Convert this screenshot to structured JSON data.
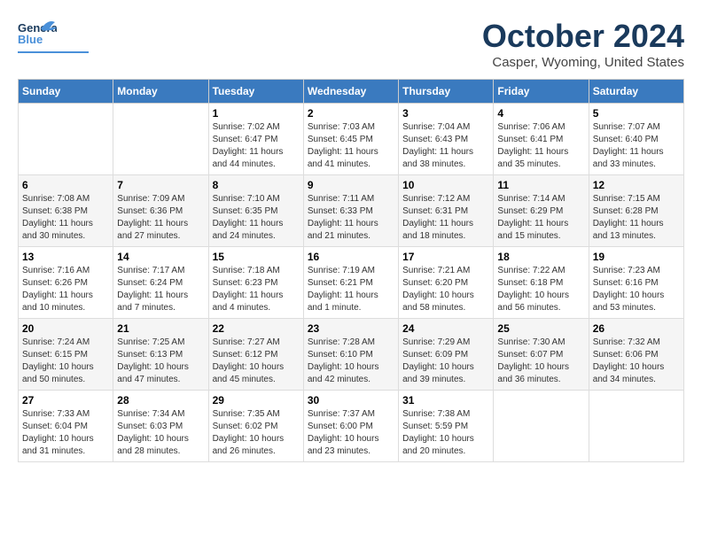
{
  "header": {
    "logo_general": "General",
    "logo_blue": "Blue",
    "month_title": "October 2024",
    "location": "Casper, Wyoming, United States"
  },
  "days_of_week": [
    "Sunday",
    "Monday",
    "Tuesday",
    "Wednesday",
    "Thursday",
    "Friday",
    "Saturday"
  ],
  "weeks": [
    [
      {
        "day": "",
        "info": ""
      },
      {
        "day": "",
        "info": ""
      },
      {
        "day": "1",
        "sunrise": "7:02 AM",
        "sunset": "6:47 PM",
        "daylight": "11 hours and 44 minutes."
      },
      {
        "day": "2",
        "sunrise": "7:03 AM",
        "sunset": "6:45 PM",
        "daylight": "11 hours and 41 minutes."
      },
      {
        "day": "3",
        "sunrise": "7:04 AM",
        "sunset": "6:43 PM",
        "daylight": "11 hours and 38 minutes."
      },
      {
        "day": "4",
        "sunrise": "7:06 AM",
        "sunset": "6:41 PM",
        "daylight": "11 hours and 35 minutes."
      },
      {
        "day": "5",
        "sunrise": "7:07 AM",
        "sunset": "6:40 PM",
        "daylight": "11 hours and 33 minutes."
      }
    ],
    [
      {
        "day": "6",
        "sunrise": "7:08 AM",
        "sunset": "6:38 PM",
        "daylight": "11 hours and 30 minutes."
      },
      {
        "day": "7",
        "sunrise": "7:09 AM",
        "sunset": "6:36 PM",
        "daylight": "11 hours and 27 minutes."
      },
      {
        "day": "8",
        "sunrise": "7:10 AM",
        "sunset": "6:35 PM",
        "daylight": "11 hours and 24 minutes."
      },
      {
        "day": "9",
        "sunrise": "7:11 AM",
        "sunset": "6:33 PM",
        "daylight": "11 hours and 21 minutes."
      },
      {
        "day": "10",
        "sunrise": "7:12 AM",
        "sunset": "6:31 PM",
        "daylight": "11 hours and 18 minutes."
      },
      {
        "day": "11",
        "sunrise": "7:14 AM",
        "sunset": "6:29 PM",
        "daylight": "11 hours and 15 minutes."
      },
      {
        "day": "12",
        "sunrise": "7:15 AM",
        "sunset": "6:28 PM",
        "daylight": "11 hours and 13 minutes."
      }
    ],
    [
      {
        "day": "13",
        "sunrise": "7:16 AM",
        "sunset": "6:26 PM",
        "daylight": "11 hours and 10 minutes."
      },
      {
        "day": "14",
        "sunrise": "7:17 AM",
        "sunset": "6:24 PM",
        "daylight": "11 hours and 7 minutes."
      },
      {
        "day": "15",
        "sunrise": "7:18 AM",
        "sunset": "6:23 PM",
        "daylight": "11 hours and 4 minutes."
      },
      {
        "day": "16",
        "sunrise": "7:19 AM",
        "sunset": "6:21 PM",
        "daylight": "11 hours and 1 minute."
      },
      {
        "day": "17",
        "sunrise": "7:21 AM",
        "sunset": "6:20 PM",
        "daylight": "10 hours and 58 minutes."
      },
      {
        "day": "18",
        "sunrise": "7:22 AM",
        "sunset": "6:18 PM",
        "daylight": "10 hours and 56 minutes."
      },
      {
        "day": "19",
        "sunrise": "7:23 AM",
        "sunset": "6:16 PM",
        "daylight": "10 hours and 53 minutes."
      }
    ],
    [
      {
        "day": "20",
        "sunrise": "7:24 AM",
        "sunset": "6:15 PM",
        "daylight": "10 hours and 50 minutes."
      },
      {
        "day": "21",
        "sunrise": "7:25 AM",
        "sunset": "6:13 PM",
        "daylight": "10 hours and 47 minutes."
      },
      {
        "day": "22",
        "sunrise": "7:27 AM",
        "sunset": "6:12 PM",
        "daylight": "10 hours and 45 minutes."
      },
      {
        "day": "23",
        "sunrise": "7:28 AM",
        "sunset": "6:10 PM",
        "daylight": "10 hours and 42 minutes."
      },
      {
        "day": "24",
        "sunrise": "7:29 AM",
        "sunset": "6:09 PM",
        "daylight": "10 hours and 39 minutes."
      },
      {
        "day": "25",
        "sunrise": "7:30 AM",
        "sunset": "6:07 PM",
        "daylight": "10 hours and 36 minutes."
      },
      {
        "day": "26",
        "sunrise": "7:32 AM",
        "sunset": "6:06 PM",
        "daylight": "10 hours and 34 minutes."
      }
    ],
    [
      {
        "day": "27",
        "sunrise": "7:33 AM",
        "sunset": "6:04 PM",
        "daylight": "10 hours and 31 minutes."
      },
      {
        "day": "28",
        "sunrise": "7:34 AM",
        "sunset": "6:03 PM",
        "daylight": "10 hours and 28 minutes."
      },
      {
        "day": "29",
        "sunrise": "7:35 AM",
        "sunset": "6:02 PM",
        "daylight": "10 hours and 26 minutes."
      },
      {
        "day": "30",
        "sunrise": "7:37 AM",
        "sunset": "6:00 PM",
        "daylight": "10 hours and 23 minutes."
      },
      {
        "day": "31",
        "sunrise": "7:38 AM",
        "sunset": "5:59 PM",
        "daylight": "10 hours and 20 minutes."
      },
      {
        "day": "",
        "info": ""
      },
      {
        "day": "",
        "info": ""
      }
    ]
  ]
}
